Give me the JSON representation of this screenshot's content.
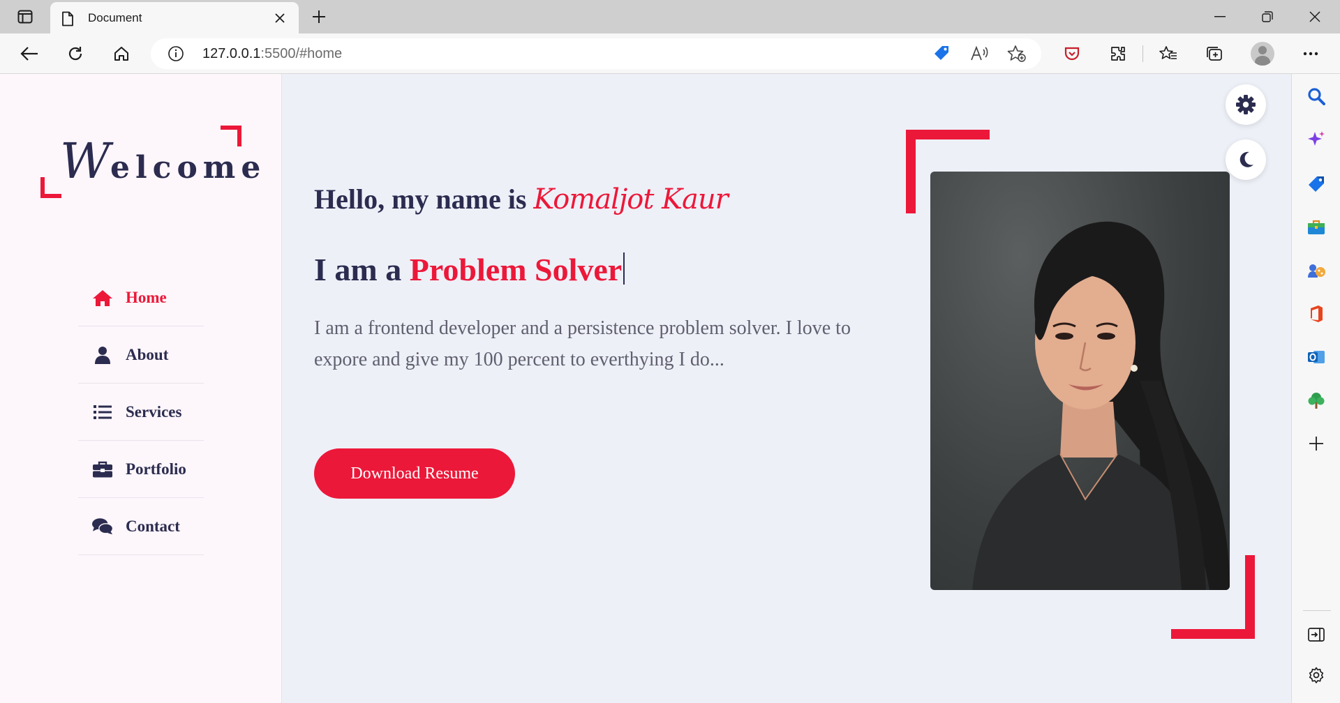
{
  "browser": {
    "tab_title": "Document",
    "url_host": "127.0.0.1",
    "url_path": ":5500/#home"
  },
  "sidebar": {
    "logo_initial": "W",
    "logo_rest": "elcome",
    "nav": [
      {
        "label": "Home",
        "icon": "home-icon",
        "active": true
      },
      {
        "label": "About",
        "icon": "user-icon",
        "active": false
      },
      {
        "label": "Services",
        "icon": "list-icon",
        "active": false
      },
      {
        "label": "Portfolio",
        "icon": "briefcase-icon",
        "active": false
      },
      {
        "label": "Contact",
        "icon": "comments-icon",
        "active": false
      }
    ]
  },
  "hero": {
    "greeting": "Hello, my name is",
    "name": "Komaljot Kaur",
    "role_prefix": "I am a",
    "role": "Problem Solver",
    "description": "I am a frontend developer and a persistence problem solver. I love to expore and give my 100 percent to everthying I do...",
    "button_label": "Download Resume"
  },
  "colors": {
    "accent": "#ec1839",
    "text_dark": "#2b2c4f",
    "page_bg": "#eef0f8",
    "aside_bg": "#fdf6fb"
  }
}
